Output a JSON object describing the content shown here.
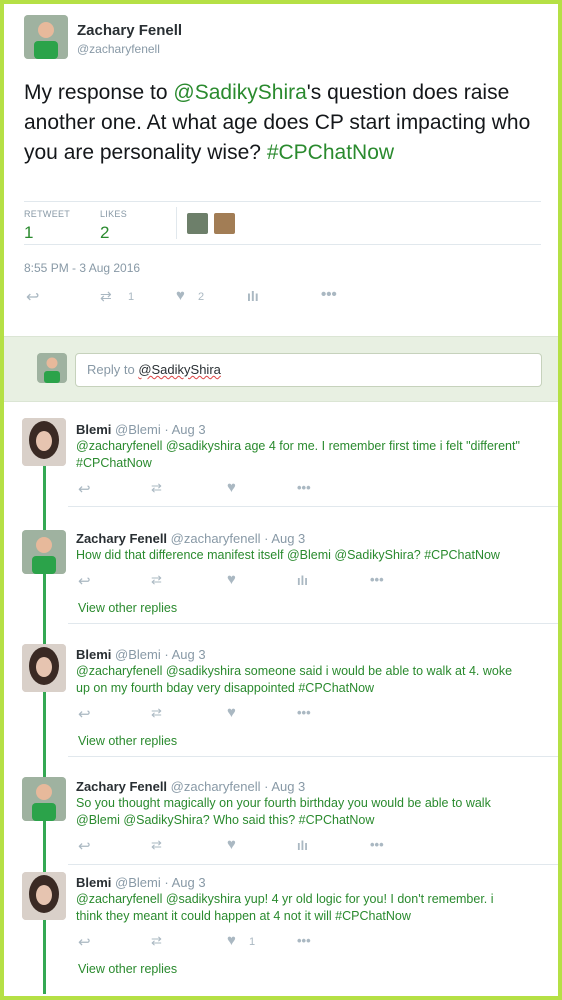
{
  "main_tweet": {
    "name": "Zachary Fenell",
    "handle": "@zacharyfenell",
    "text_prefix": "My response to ",
    "text_mention": "@SadikyShira",
    "text_body": "'s question does raise another one. At what age does CP start impacting who you are personality wise?",
    "hashtag": "#CPChatNow",
    "retweet_label": "RETWEET",
    "retweet_count": "1",
    "likes_label": "LIKES",
    "likes_count": "2",
    "timestamp": "8:55 PM - 3 Aug 2016",
    "action_retweet_count": "1",
    "action_like_count": "2"
  },
  "reply_box": {
    "prefix": "Reply to ",
    "mention": "@SadikyShira"
  },
  "replies": [
    {
      "name": "Blemi",
      "handle": "@Blemi",
      "date": "· Aug 3",
      "line1": "@zacharyfenell @sadikyshira age 4 for me. I remember first time i felt \"different\"",
      "line2": "#CPChatNow",
      "like_count": "",
      "view_other": ""
    },
    {
      "name": "Zachary Fenell",
      "handle": "@zacharyfenell",
      "date": "· Aug 3",
      "line1": "How did that difference manifest itself @Blemi @SadikyShira? #CPChatNow",
      "line2": "",
      "like_count": "",
      "view_other": "View other replies"
    },
    {
      "name": "Blemi",
      "handle": "@Blemi",
      "date": "· Aug 3",
      "line1": "@zacharyfenell @sadikyshira someone said i would be able to walk at 4. woke",
      "line2": "up on my fourth bday very disappointed #CPChatNow",
      "like_count": "",
      "view_other": "View other replies"
    },
    {
      "name": "Zachary Fenell",
      "handle": "@zacharyfenell",
      "date": "· Aug 3",
      "line1": "So you thought magically on your fourth birthday you would be able to walk",
      "line2": "@Blemi @SadikyShira? Who said this? #CPChatNow",
      "like_count": "",
      "view_other": ""
    },
    {
      "name": "Blemi",
      "handle": "@Blemi",
      "date": "· Aug 3",
      "line1": "@zacharyfenell @sadikyshira yup! 4 yr old logic for you! I don't remember. i",
      "line2": "think they  meant it could happen at 4 not it will #CPChatNow",
      "like_count": "1",
      "view_other": "View other replies"
    }
  ],
  "icons": {
    "reply": "reply-icon",
    "retweet": "retweet-icon",
    "like": "heart-icon",
    "analytics": "analytics-icon",
    "more": "more-icon"
  },
  "colors": {
    "frame": "#b5e045",
    "link": "#2a8a2e",
    "thread_line": "#34a853"
  }
}
